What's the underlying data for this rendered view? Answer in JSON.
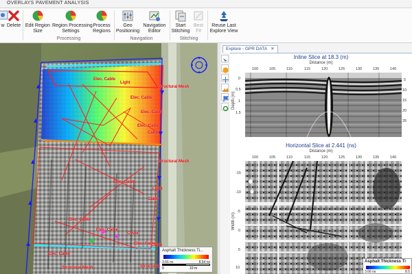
{
  "tabs": [
    "OVERLAYS",
    "PAVEMENT ANALYSIS"
  ],
  "ribbon": {
    "buttons": [
      {
        "id": "view",
        "label": "w",
        "icon": "view-icon"
      },
      {
        "id": "delete",
        "label": "Delete",
        "icon": "delete-x-icon"
      },
      {
        "id": "edit_region_size",
        "label": "Edit Region\nSize",
        "icon": "pie-chart-icon"
      },
      {
        "id": "region_processing_settings",
        "label": "Region Processing\nSettings",
        "icon": "pie-chart-icon"
      },
      {
        "id": "process_regions",
        "label": "Process\nRegions",
        "icon": "pie-chart-icon"
      },
      {
        "id": "geo_positioning",
        "label": "Geo\nPositioning",
        "icon": "geo-sliders-icon"
      },
      {
        "id": "navigation_editor",
        "label": "Navigation\nEditor",
        "icon": "nav-editor-icon"
      },
      {
        "id": "start_stitching",
        "label": "Start\nStitching",
        "icon": "stitch-icon"
      },
      {
        "id": "best_fit",
        "label": "Best\nFit",
        "icon": "best-fit-icon"
      },
      {
        "id": "reuse_last_explore_view",
        "label": "Reuse Last\nExplore View",
        "icon": "recycle-icon"
      }
    ],
    "groups": [
      "Processing",
      "Navigation",
      "Stitching"
    ]
  },
  "map": {
    "labels": [
      "Elec. Cable",
      "Light",
      "Structural Mesh",
      "Elec. Cable",
      "Elec. Cable",
      "Elec. Cable",
      "Structural Mesh",
      "Cable",
      "Light",
      "Cable",
      "Elec. Cable",
      "Elec. Cable",
      "Elec. Cable",
      "Elec. Cable",
      "Elec. Cable",
      "Cover",
      "Cable",
      "Structural",
      "Structural Mesh"
    ],
    "legend": {
      "title": "Asphalt Thickness Ti...",
      "low": "3.66 ns",
      "high": "8.54 ns"
    },
    "scale": {
      "zero": "0",
      "ten": "10 m"
    }
  },
  "explore": {
    "tab_label": "Explore - GPR DATA",
    "close": "✕",
    "inline": {
      "title": "Inline Slice at 18.3 (m)",
      "xlabel": "Distance (m)",
      "ylabel": "Depth (m)",
      "xticks": [
        "100",
        "105",
        "110",
        "115",
        "120",
        "125",
        "130",
        "135",
        "140"
      ],
      "yticks_left": [
        "0",
        "0.5",
        "1",
        "1.5"
      ],
      "yticks_right": [
        "5",
        "10",
        "15",
        "20",
        "25"
      ]
    },
    "horizontal": {
      "title": "Horizontal Slice at 2.441 (ns)",
      "xlabel": "Distance (m)",
      "ylabel": "Width (m)",
      "xticks": [
        "100",
        "105",
        "110",
        "115",
        "120",
        "125",
        "130",
        "135",
        "140"
      ],
      "yticks": [
        "-15",
        "-10",
        "-5",
        "0",
        "5",
        "10"
      ]
    },
    "legend": {
      "title": "Asphalt Thickness Ti",
      "low": "3.66 ns",
      "high": "8.5"
    }
  },
  "colors": {
    "accent": "#2b4d7e",
    "label_red": "#e00000",
    "track_blue": "#1a1aff"
  }
}
